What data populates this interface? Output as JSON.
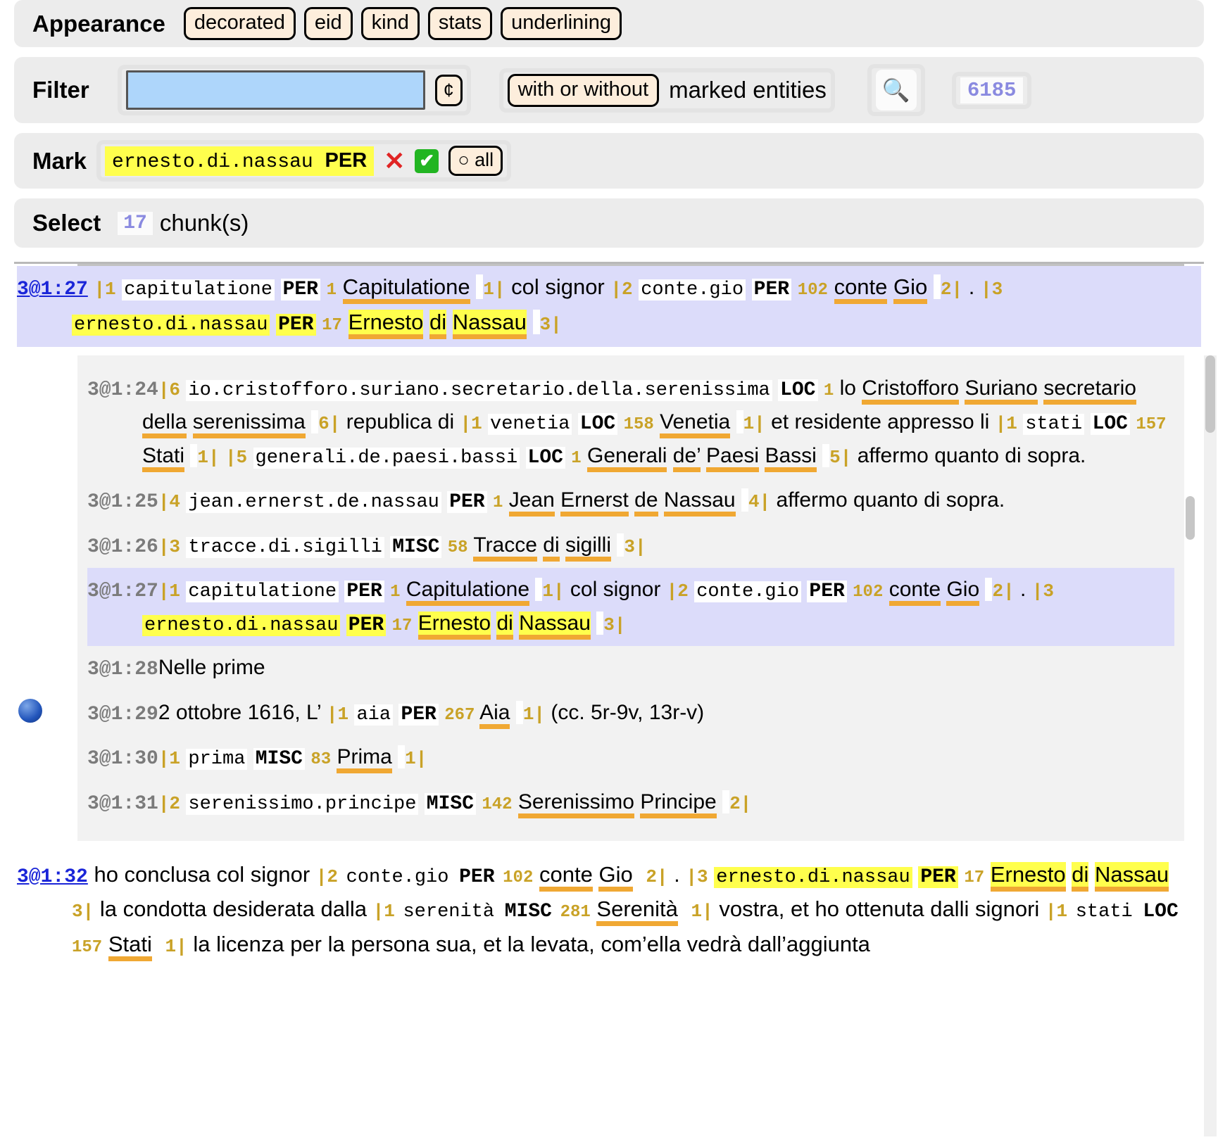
{
  "appearance": {
    "label": "Appearance",
    "buttons": [
      "decorated",
      "eid",
      "kind",
      "stats",
      "underlining"
    ]
  },
  "filter": {
    "label": "Filter",
    "value": "",
    "placeholder": "",
    "cent_button": "¢",
    "mode_button": "with or without",
    "mode_text": "marked entities",
    "search_icon": "🔍",
    "count": "6185"
  },
  "mark": {
    "label": "Mark",
    "chip_eid": "ernesto.di.nassau",
    "chip_kind": "PER",
    "remove_icon": "✕",
    "accept_icon": "✔",
    "all_button": "○ all"
  },
  "select": {
    "label": "Select",
    "count": "17",
    "unit": "chunk(s)"
  },
  "top_chunk": {
    "id": "3@1:27",
    "tokens": [
      {
        "t": "bar",
        "v": "|1"
      },
      {
        "t": "eid",
        "v": "capitulatione"
      },
      {
        "t": "kind",
        "v": "PER"
      },
      {
        "t": "stat",
        "v": "1"
      },
      {
        "t": "surf-u",
        "v": "Capitulatione"
      },
      {
        "t": "pad",
        "v": " "
      },
      {
        "t": "bar",
        "v": "1|"
      },
      {
        "t": "surf",
        "v": "col signor "
      },
      {
        "t": "bar",
        "v": "|2"
      },
      {
        "t": "eid",
        "v": "conte.gio"
      },
      {
        "t": "kind",
        "v": "PER"
      },
      {
        "t": "stat",
        "v": "102"
      },
      {
        "t": "surf-u",
        "v": "conte"
      },
      {
        "t": "surf",
        "v": " "
      },
      {
        "t": "surf-u",
        "v": "Gio"
      },
      {
        "t": "pad",
        "v": " "
      },
      {
        "t": "bar",
        "v": "2|"
      },
      {
        "t": "surf",
        "v": ". "
      },
      {
        "t": "bar",
        "v": "|3"
      },
      {
        "t": "eid-hl",
        "v": "ernesto.di.nassau"
      },
      {
        "t": "kind-hl",
        "v": "PER"
      },
      {
        "t": "stat",
        "v": "17"
      },
      {
        "t": "surf-u-hl",
        "v": "Ernesto"
      },
      {
        "t": "surf",
        "v": " "
      },
      {
        "t": "surf-u-hl",
        "v": "di"
      },
      {
        "t": "surf",
        "v": " "
      },
      {
        "t": "surf-u-hl",
        "v": "Nassau"
      },
      {
        "t": "pad",
        "v": " "
      },
      {
        "t": "bar",
        "v": "3|"
      }
    ]
  },
  "inner_chunks": [
    {
      "id": "3@1:24",
      "selected": false,
      "tokens": [
        {
          "t": "bar",
          "v": "|6"
        },
        {
          "t": "eid",
          "v": "io.cristofforo.suriano.secretario.della.serenissima"
        },
        {
          "t": "kind",
          "v": "LOC"
        },
        {
          "t": "stat",
          "v": "1"
        },
        {
          "t": "surf",
          "v": "lo "
        },
        {
          "t": "surf-u",
          "v": "Cristofforo"
        },
        {
          "t": "surf",
          "v": " "
        },
        {
          "t": "surf-u",
          "v": "Suriano"
        },
        {
          "t": "surf",
          "v": " "
        },
        {
          "t": "surf-u",
          "v": "secretario"
        },
        {
          "t": "surf",
          "v": " "
        },
        {
          "t": "surf-u",
          "v": "della"
        },
        {
          "t": "surf",
          "v": " "
        },
        {
          "t": "surf-u",
          "v": "serenissima"
        },
        {
          "t": "pad",
          "v": " "
        },
        {
          "t": "bar",
          "v": "6|"
        },
        {
          "t": "surf",
          "v": " republica di "
        },
        {
          "t": "bar",
          "v": "|1"
        },
        {
          "t": "eid",
          "v": "venetia"
        },
        {
          "t": "kind",
          "v": "LOC"
        },
        {
          "t": "stat",
          "v": "158"
        },
        {
          "t": "surf-u",
          "v": "Venetia"
        },
        {
          "t": "pad",
          "v": " "
        },
        {
          "t": "bar",
          "v": "1|"
        },
        {
          "t": "surf",
          "v": "et residente appresso li "
        },
        {
          "t": "bar",
          "v": "|1"
        },
        {
          "t": "eid",
          "v": "stati"
        },
        {
          "t": "kind",
          "v": "LOC"
        },
        {
          "t": "stat",
          "v": "157"
        },
        {
          "t": "surf-u",
          "v": "Stati"
        },
        {
          "t": "pad",
          "v": " "
        },
        {
          "t": "bar",
          "v": "1|"
        },
        {
          "t": "bar",
          "v": "|5"
        },
        {
          "t": "eid",
          "v": "generali.de.paesi.bassi"
        },
        {
          "t": "kind",
          "v": "LOC"
        },
        {
          "t": "stat",
          "v": "1"
        },
        {
          "t": "surf-u",
          "v": "Generali"
        },
        {
          "t": "surf",
          "v": " "
        },
        {
          "t": "surf-u",
          "v": "de’"
        },
        {
          "t": "surf",
          "v": " "
        },
        {
          "t": "surf-u",
          "v": "Paesi"
        },
        {
          "t": "surf",
          "v": " "
        },
        {
          "t": "surf-u",
          "v": "Bassi"
        },
        {
          "t": "pad",
          "v": " "
        },
        {
          "t": "bar",
          "v": "5|"
        },
        {
          "t": "surf",
          "v": "affermo quanto di sopra."
        }
      ]
    },
    {
      "id": "3@1:25",
      "selected": false,
      "tokens": [
        {
          "t": "bar",
          "v": "|4"
        },
        {
          "t": "eid",
          "v": "jean.ernerst.de.nassau"
        },
        {
          "t": "kind",
          "v": "PER"
        },
        {
          "t": "stat",
          "v": "1"
        },
        {
          "t": "surf-u",
          "v": "Jean"
        },
        {
          "t": "surf",
          "v": " "
        },
        {
          "t": "surf-u",
          "v": "Ernerst"
        },
        {
          "t": "surf",
          "v": " "
        },
        {
          "t": "surf-u",
          "v": "de"
        },
        {
          "t": "surf",
          "v": " "
        },
        {
          "t": "surf-u",
          "v": "Nassau"
        },
        {
          "t": "pad",
          "v": " "
        },
        {
          "t": "bar",
          "v": "4|"
        },
        {
          "t": "surf",
          "v": " affermo quanto di sopra."
        }
      ]
    },
    {
      "id": "3@1:26",
      "selected": false,
      "tokens": [
        {
          "t": "bar",
          "v": "|3"
        },
        {
          "t": "eid",
          "v": "tracce.di.sigilli"
        },
        {
          "t": "kind",
          "v": "MISC"
        },
        {
          "t": "stat",
          "v": "58"
        },
        {
          "t": "surf-u",
          "v": "Tracce"
        },
        {
          "t": "surf",
          "v": " "
        },
        {
          "t": "surf-u",
          "v": "di"
        },
        {
          "t": "surf",
          "v": " "
        },
        {
          "t": "surf-u",
          "v": "sigilli"
        },
        {
          "t": "pad",
          "v": " "
        },
        {
          "t": "bar",
          "v": "3|"
        }
      ]
    },
    {
      "id": "3@1:27",
      "selected": true,
      "tokens": [
        {
          "t": "bar",
          "v": "|1"
        },
        {
          "t": "eid",
          "v": "capitulatione"
        },
        {
          "t": "kind",
          "v": "PER"
        },
        {
          "t": "stat",
          "v": "1"
        },
        {
          "t": "surf-u",
          "v": "Capitulatione"
        },
        {
          "t": "pad",
          "v": " "
        },
        {
          "t": "bar",
          "v": "1|"
        },
        {
          "t": "surf",
          "v": "col signor "
        },
        {
          "t": "bar",
          "v": "|2"
        },
        {
          "t": "eid",
          "v": "conte.gio"
        },
        {
          "t": "kind",
          "v": "PER"
        },
        {
          "t": "stat",
          "v": "102"
        },
        {
          "t": "surf-u",
          "v": "conte"
        },
        {
          "t": "surf",
          "v": " "
        },
        {
          "t": "surf-u",
          "v": "Gio"
        },
        {
          "t": "pad",
          "v": " "
        },
        {
          "t": "bar",
          "v": "2|"
        },
        {
          "t": "surf",
          "v": ". "
        },
        {
          "t": "bar",
          "v": "|3"
        },
        {
          "t": "eid-hl",
          "v": "ernesto.di.nassau"
        },
        {
          "t": "kind-hl",
          "v": "PER"
        },
        {
          "t": "stat",
          "v": "17"
        },
        {
          "t": "surf-u-hl",
          "v": "Ernesto"
        },
        {
          "t": "surf",
          "v": " "
        },
        {
          "t": "surf-u-hl",
          "v": "di"
        },
        {
          "t": "surf",
          "v": " "
        },
        {
          "t": "surf-u-hl",
          "v": "Nassau"
        },
        {
          "t": "pad",
          "v": " "
        },
        {
          "t": "bar",
          "v": "3|"
        }
      ]
    },
    {
      "id": "3@1:28",
      "selected": false,
      "tokens": [
        {
          "t": "surf",
          "v": "Nelle prime"
        }
      ]
    },
    {
      "id": "3@1:29",
      "selected": false,
      "tokens": [
        {
          "t": "surf",
          "v": "2 ottobre 1616, L’"
        },
        {
          "t": "bar",
          "v": "|1"
        },
        {
          "t": "eid",
          "v": "aia"
        },
        {
          "t": "kind",
          "v": "PER"
        },
        {
          "t": "stat",
          "v": "267"
        },
        {
          "t": "surf-u",
          "v": "Aia"
        },
        {
          "t": "pad",
          "v": " "
        },
        {
          "t": "bar",
          "v": "1|"
        },
        {
          "t": "surf",
          "v": "(cc. 5r-9v, 13r-v)"
        }
      ]
    },
    {
      "id": "3@1:30",
      "selected": false,
      "tokens": [
        {
          "t": "bar",
          "v": "|1"
        },
        {
          "t": "eid",
          "v": "prima"
        },
        {
          "t": "kind",
          "v": "MISC"
        },
        {
          "t": "stat",
          "v": "83"
        },
        {
          "t": "surf-u",
          "v": "Prima"
        },
        {
          "t": "pad",
          "v": " "
        },
        {
          "t": "bar",
          "v": "1|"
        }
      ]
    },
    {
      "id": "3@1:31",
      "selected": false,
      "tokens": [
        {
          "t": "bar",
          "v": "|2"
        },
        {
          "t": "eid",
          "v": "serenissimo.principe"
        },
        {
          "t": "kind",
          "v": "MISC"
        },
        {
          "t": "stat",
          "v": "142"
        },
        {
          "t": "surf-u",
          "v": "Serenissimo"
        },
        {
          "t": "surf",
          "v": " "
        },
        {
          "t": "surf-u",
          "v": "Principe"
        },
        {
          "t": "pad",
          "v": " "
        },
        {
          "t": "bar",
          "v": "2|"
        }
      ]
    }
  ],
  "bottom_chunk": {
    "id": "3@1:32",
    "tokens": [
      {
        "t": "surf",
        "v": "ho conclusa col signor "
      },
      {
        "t": "bar",
        "v": "|2"
      },
      {
        "t": "eid",
        "v": "conte.gio"
      },
      {
        "t": "kind",
        "v": "PER"
      },
      {
        "t": "stat",
        "v": "102"
      },
      {
        "t": "surf-u",
        "v": "conte"
      },
      {
        "t": "surf",
        "v": " "
      },
      {
        "t": "surf-u",
        "v": "Gio"
      },
      {
        "t": "pad",
        "v": " "
      },
      {
        "t": "bar",
        "v": "2|"
      },
      {
        "t": "surf",
        "v": ". "
      },
      {
        "t": "bar",
        "v": "|3"
      },
      {
        "t": "eid-hl",
        "v": "ernesto.di.nassau"
      },
      {
        "t": "kind-hl",
        "v": "PER"
      },
      {
        "t": "stat",
        "v": "17"
      },
      {
        "t": "surf-u-hl",
        "v": "Ernesto"
      },
      {
        "t": "surf",
        "v": " "
      },
      {
        "t": "surf-u-hl",
        "v": "di"
      },
      {
        "t": "surf",
        "v": " "
      },
      {
        "t": "surf-u-hl",
        "v": "Nassau"
      },
      {
        "t": "pad",
        "v": " "
      },
      {
        "t": "bar",
        "v": "3|"
      },
      {
        "t": "surf",
        "v": "la condotta desiderata dalla "
      },
      {
        "t": "bar",
        "v": "|1"
      },
      {
        "t": "eid",
        "v": "serenità"
      },
      {
        "t": "kind",
        "v": "MISC"
      },
      {
        "t": "stat",
        "v": "281"
      },
      {
        "t": "surf-u",
        "v": "Serenità"
      },
      {
        "t": "pad",
        "v": " "
      },
      {
        "t": "bar",
        "v": "1|"
      },
      {
        "t": "surf",
        "v": "vostra, et ho ottenuta dalli signori "
      },
      {
        "t": "bar",
        "v": "|1"
      },
      {
        "t": "eid",
        "v": "stati"
      },
      {
        "t": "kind",
        "v": "LOC"
      },
      {
        "t": "stat",
        "v": "157"
      },
      {
        "t": "surf-u",
        "v": "Stati"
      },
      {
        "t": "pad",
        "v": " "
      },
      {
        "t": "bar",
        "v": "1|"
      },
      {
        "t": "surf",
        "v": " la licenza per la persona sua, et la levata, com’ella vedrà dall’aggiunta"
      }
    ]
  }
}
